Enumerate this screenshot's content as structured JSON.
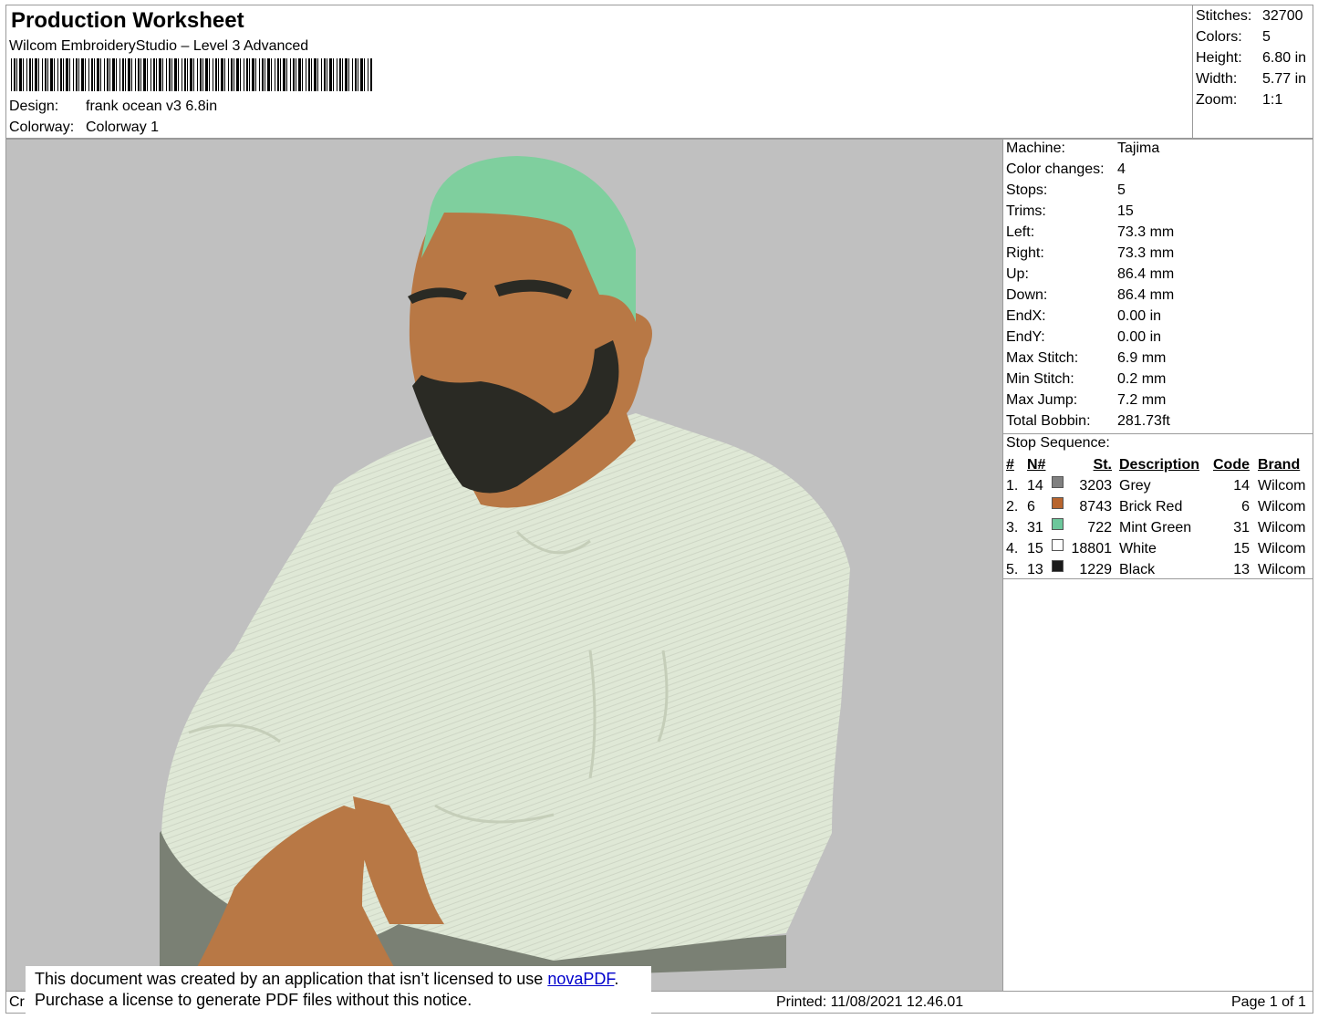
{
  "header": {
    "title": "Production Worksheet",
    "software": "Wilcom EmbroideryStudio – Level 3 Advanced",
    "design_label": "Design:",
    "design_value": "frank ocean v3 6.8in",
    "colorway_label": "Colorway:",
    "colorway_value": "Colorway 1"
  },
  "summary": [
    {
      "label": "Stitches:",
      "value": "32700"
    },
    {
      "label": "Colors:",
      "value": "5"
    },
    {
      "label": "Height:",
      "value": "6.80 in"
    },
    {
      "label": "Width:",
      "value": "5.77 in"
    },
    {
      "label": "Zoom:",
      "value": "1:1"
    }
  ],
  "machine_info": [
    {
      "label": "Machine:",
      "value": "Tajima"
    },
    {
      "label": "Color changes:",
      "value": "4"
    },
    {
      "label": "Stops:",
      "value": "5"
    },
    {
      "label": "Trims:",
      "value": "15"
    },
    {
      "label": "Left:",
      "value": "73.3 mm"
    },
    {
      "label": "Right:",
      "value": "73.3 mm"
    },
    {
      "label": "Up:",
      "value": "86.4 mm"
    },
    {
      "label": "Down:",
      "value": "86.4 mm"
    },
    {
      "label": "EndX:",
      "value": "0.00 in"
    },
    {
      "label": "EndY:",
      "value": "0.00 in"
    },
    {
      "label": "Max Stitch:",
      "value": "6.9 mm"
    },
    {
      "label": "Min Stitch:",
      "value": "0.2 mm"
    },
    {
      "label": "Max Jump:",
      "value": "7.2 mm"
    },
    {
      "label": "Total Bobbin:",
      "value": "281.73ft"
    }
  ],
  "stop_sequence": {
    "title": "Stop Sequence:",
    "headers": {
      "num": "#",
      "n": "N#",
      "st": "St.",
      "desc": "Description",
      "code": "Code",
      "brand": "Brand"
    },
    "rows": [
      {
        "num": "1.",
        "n": "14",
        "color": "#808080",
        "st": "3203",
        "desc": "Grey",
        "code": "14",
        "brand": "Wilcom"
      },
      {
        "num": "2.",
        "n": "6",
        "color": "#b8652e",
        "st": "8743",
        "desc": "Brick Red",
        "code": "6",
        "brand": "Wilcom"
      },
      {
        "num": "3.",
        "n": "31",
        "color": "#6cc79b",
        "st": "722",
        "desc": "Mint Green",
        "code": "31",
        "brand": "Wilcom"
      },
      {
        "num": "4.",
        "n": "15",
        "color": "#ffffff",
        "st": "18801",
        "desc": "White",
        "code": "15",
        "brand": "Wilcom"
      },
      {
        "num": "5.",
        "n": "13",
        "color": "#1a1a1a",
        "st": "1229",
        "desc": "Black",
        "code": "13",
        "brand": "Wilcom"
      }
    ]
  },
  "footer": {
    "left_fragment": "Cr",
    "printed": "Printed: 11/08/2021 12.46.01",
    "page": "Page 1 of 1"
  },
  "notice": {
    "line1_pre": "This document was created by an application that isn’t licensed to use ",
    "link": "novaPDF",
    "line1_post": ".",
    "line2": "Purchase a license to generate PDF files without this notice."
  },
  "colors": {
    "canvas_bg": "#c0c0c0",
    "grey": "#7a8074",
    "skin": "#b87845",
    "hair": "#7fcf9e",
    "shirt": "#dfe8d6",
    "beard": "#2a2a24"
  }
}
